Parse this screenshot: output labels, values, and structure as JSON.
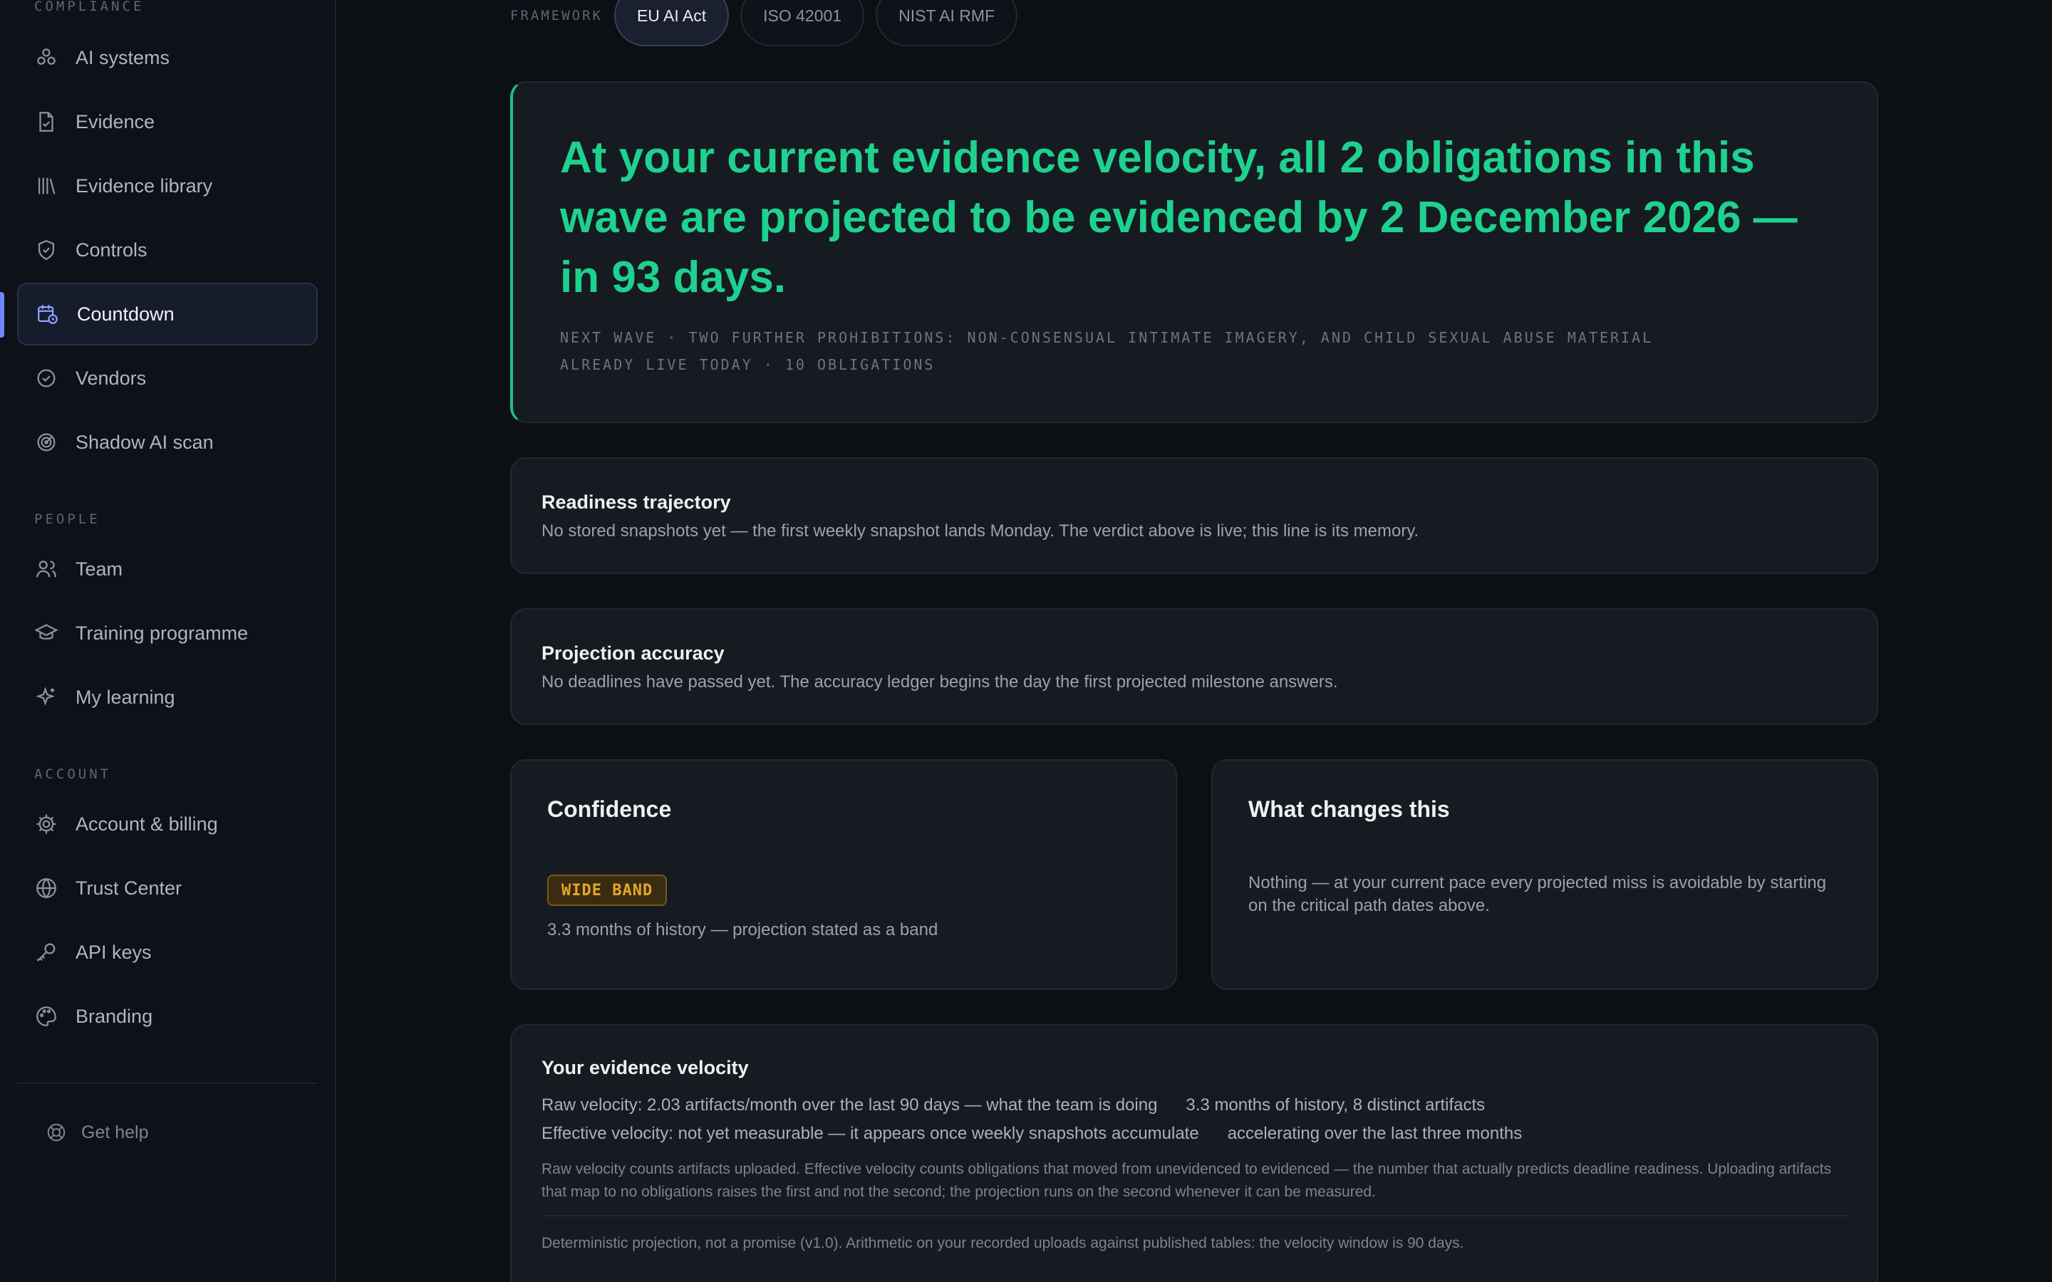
{
  "sidebar": {
    "sections": {
      "compliance": "COMPLIANCE",
      "people": "PEOPLE",
      "account": "ACCOUNT"
    },
    "items": [
      {
        "label": "AI systems",
        "icon": "ai-systems-icon"
      },
      {
        "label": "Evidence",
        "icon": "file-check-icon"
      },
      {
        "label": "Evidence library",
        "icon": "library-icon"
      },
      {
        "label": "Controls",
        "icon": "shield-check-icon"
      },
      {
        "label": "Countdown",
        "icon": "calendar-clock-icon",
        "active": true
      },
      {
        "label": "Vendors",
        "icon": "badge-check-icon"
      },
      {
        "label": "Shadow AI scan",
        "icon": "radar-icon"
      },
      {
        "label": "Team",
        "icon": "users-icon"
      },
      {
        "label": "Training programme",
        "icon": "graduation-cap-icon"
      },
      {
        "label": "My learning",
        "icon": "sparkles-icon"
      },
      {
        "label": "Account & billing",
        "icon": "gear-icon"
      },
      {
        "label": "Trust Center",
        "icon": "globe-icon"
      },
      {
        "label": "API keys",
        "icon": "key-icon"
      },
      {
        "label": "Branding",
        "icon": "palette-icon"
      }
    ],
    "help": "Get help"
  },
  "framework": {
    "label": "FRAMEWORK",
    "options": [
      "EU AI Act",
      "ISO 42001",
      "NIST AI RMF"
    ],
    "selected": "EU AI Act"
  },
  "hero": {
    "headline": "At your current evidence velocity, all 2 obligations in this wave are projected to be evidenced by 2 December 2026 — in 93 days.",
    "next_wave": "NEXT WAVE · TWO FURTHER PROHIBITIONS: NON-CONSENSUAL INTIMATE IMAGERY, AND CHILD SEXUAL ABUSE MATERIAL",
    "already_live": "ALREADY LIVE TODAY · 10 OBLIGATIONS"
  },
  "readiness": {
    "title": "Readiness trajectory",
    "body": "No stored snapshots yet — the first weekly snapshot lands Monday. The verdict above is live; this line is its memory."
  },
  "accuracy": {
    "title": "Projection accuracy",
    "body": "No deadlines have passed yet. The accuracy ledger begins the day the first projected milestone answers."
  },
  "confidence": {
    "title": "Confidence",
    "badge": "WIDE BAND",
    "body": "3.3 months of history — projection stated as a band"
  },
  "changes": {
    "title": "What changes this",
    "body": "Nothing — at your current pace every projected miss is avoidable by starting on the critical path dates above."
  },
  "velocity": {
    "title": "Your evidence velocity",
    "raw": "Raw velocity: 2.03 artifacts/month over the last 90 days — what the team is doing",
    "raw_side": "3.3 months of history, 8 distinct artifacts",
    "effective": "Effective velocity: not yet measurable — it appears once weekly snapshots accumulate",
    "effective_side": "accelerating over the last three months",
    "explanation": "Raw velocity counts artifacts uploaded. Effective velocity counts obligations that moved from unevidenced to evidenced — the number that actually predicts deadline readiness. Uploading artifacts that map to no obligations raises the first and not the second; the projection runs on the second whenever it can be measured.",
    "footer": "Deterministic projection, not a promise (v1.0). Arithmetic on your recorded uploads against published tables: the velocity window is 90 days."
  },
  "colors": {
    "accent_green": "#1fd18e",
    "active_nav": "#6f86ff",
    "badge_amber": "#e6a52a"
  }
}
